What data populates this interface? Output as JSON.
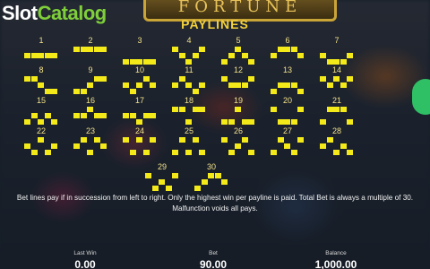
{
  "brand": {
    "part1": "Slot",
    "part2": "Catalog"
  },
  "game_title": "FORTUNE",
  "paylines_title": "PAYLINES",
  "paylines": [
    {
      "number": "1",
      "pattern": [
        1,
        1,
        1,
        1,
        1
      ]
    },
    {
      "number": "2",
      "pattern": [
        0,
        0,
        0,
        0,
        0
      ]
    },
    {
      "number": "3",
      "pattern": [
        2,
        2,
        2,
        2,
        2
      ]
    },
    {
      "number": "4",
      "pattern": [
        0,
        1,
        2,
        1,
        0
      ]
    },
    {
      "number": "5",
      "pattern": [
        2,
        1,
        0,
        1,
        2
      ]
    },
    {
      "number": "6",
      "pattern": [
        1,
        0,
        0,
        0,
        1
      ]
    },
    {
      "number": "7",
      "pattern": [
        1,
        2,
        2,
        2,
        1
      ]
    },
    {
      "number": "8",
      "pattern": [
        0,
        0,
        1,
        2,
        2
      ]
    },
    {
      "number": "9",
      "pattern": [
        2,
        2,
        1,
        0,
        0
      ]
    },
    {
      "number": "10",
      "pattern": [
        1,
        2,
        1,
        0,
        1
      ]
    },
    {
      "number": "11",
      "pattern": [
        1,
        0,
        1,
        2,
        1
      ]
    },
    {
      "number": "12",
      "pattern": [
        0,
        1,
        1,
        1,
        0
      ]
    },
    {
      "number": "13",
      "pattern": [
        2,
        1,
        1,
        1,
        2
      ]
    },
    {
      "number": "14",
      "pattern": [
        0,
        1,
        0,
        1,
        0
      ]
    },
    {
      "number": "15",
      "pattern": [
        2,
        1,
        2,
        1,
        2
      ]
    },
    {
      "number": "16",
      "pattern": [
        1,
        1,
        0,
        1,
        1
      ]
    },
    {
      "number": "17",
      "pattern": [
        1,
        1,
        2,
        1,
        1
      ]
    },
    {
      "number": "18",
      "pattern": [
        0,
        0,
        2,
        0,
        0
      ]
    },
    {
      "number": "19",
      "pattern": [
        2,
        2,
        0,
        2,
        2
      ]
    },
    {
      "number": "20",
      "pattern": [
        0,
        2,
        2,
        2,
        0
      ]
    },
    {
      "number": "21",
      "pattern": [
        2,
        0,
        0,
        0,
        2
      ]
    },
    {
      "number": "22",
      "pattern": [
        1,
        2,
        0,
        2,
        1
      ]
    },
    {
      "number": "23",
      "pattern": [
        1,
        0,
        2,
        0,
        1
      ]
    },
    {
      "number": "24",
      "pattern": [
        0,
        2,
        0,
        2,
        0
      ]
    },
    {
      "number": "25",
      "pattern": [
        2,
        0,
        2,
        0,
        2
      ]
    },
    {
      "number": "26",
      "pattern": [
        0,
        2,
        1,
        0,
        2
      ]
    },
    {
      "number": "27",
      "pattern": [
        2,
        0,
        1,
        2,
        0
      ]
    },
    {
      "number": "28",
      "pattern": [
        1,
        0,
        2,
        1,
        2
      ]
    },
    {
      "number": "29",
      "pattern": [
        0,
        2,
        1,
        2,
        0
      ]
    },
    {
      "number": "30",
      "pattern": [
        2,
        1,
        0,
        0,
        1
      ]
    }
  ],
  "info_text": "Bet lines pay if in succession from left to right. Only the highest win per payline is paid. Total Bet is always a multiple of 30. Malfunction voids all pays.",
  "stats": {
    "last_win": {
      "label": "Last Win",
      "value": "0.00"
    },
    "bet": {
      "label": "Bet",
      "value": "90.00"
    },
    "balance": {
      "label": "Balance",
      "value": "1,000.00"
    }
  },
  "colors": {
    "line": "#f4ea1a",
    "title": "#f3d13a",
    "brand_green": "#7fcf3a"
  }
}
